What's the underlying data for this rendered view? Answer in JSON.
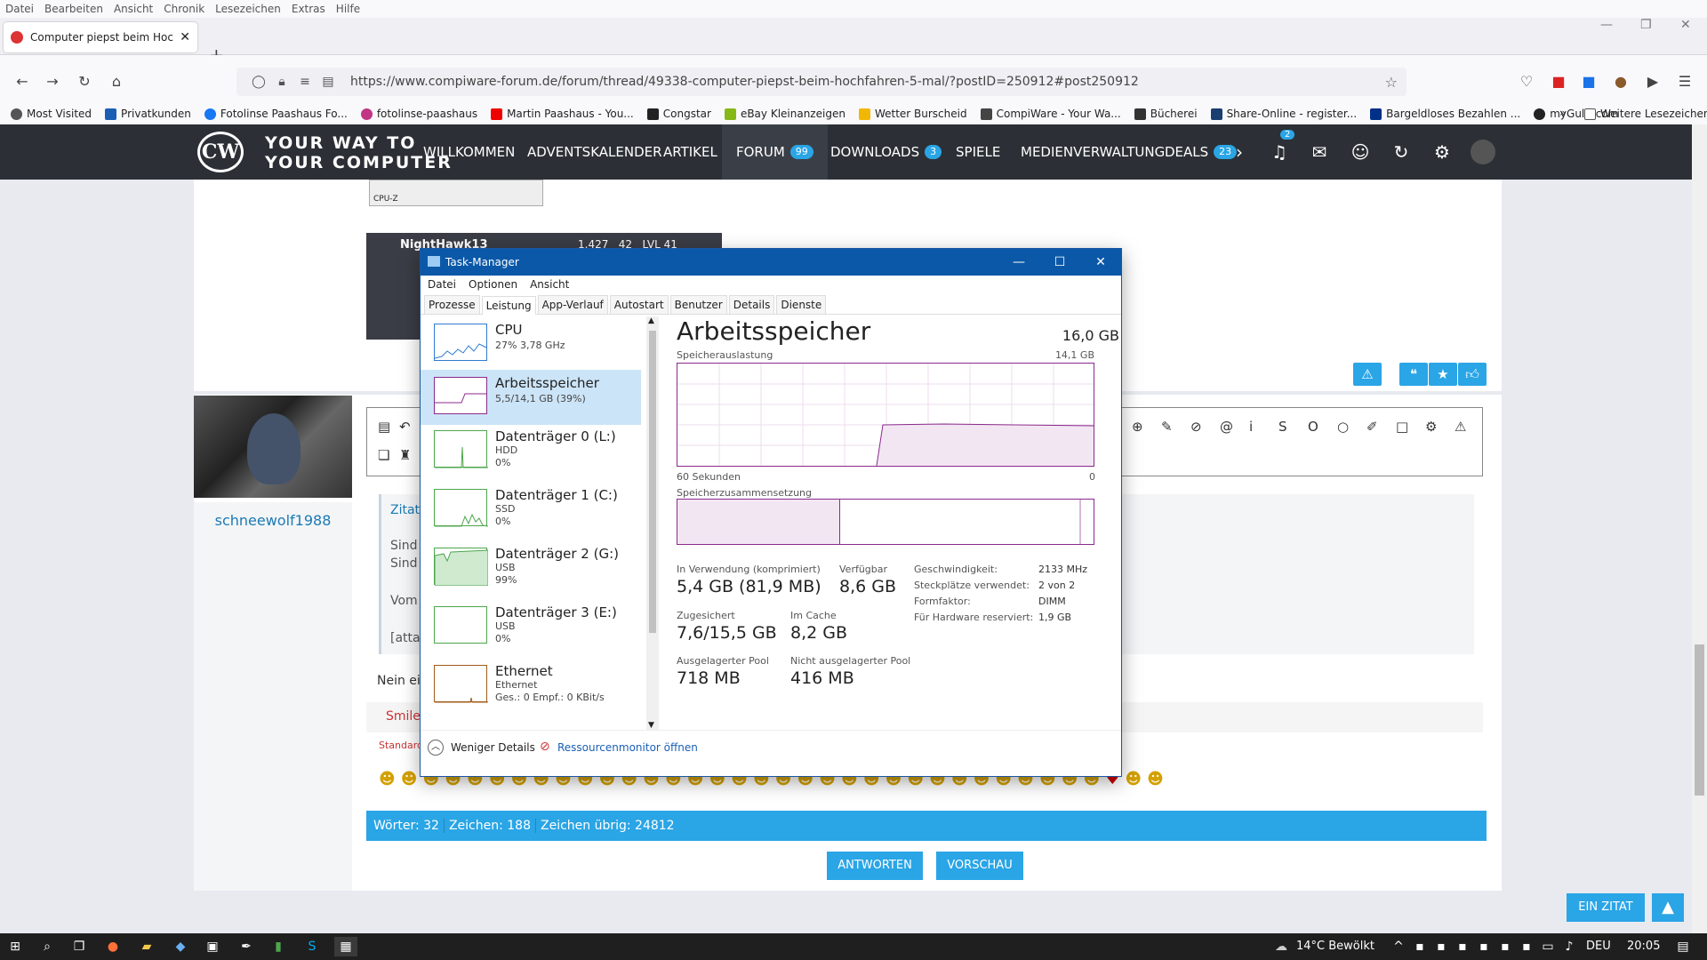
{
  "browser": {
    "menu": [
      "Datei",
      "Bearbeiten",
      "Ansicht",
      "Chronik",
      "Lesezeichen",
      "Extras",
      "Hilfe"
    ],
    "tab_title": "Computer piepst beim Hochfa",
    "url": "https://www.compiware-forum.de/forum/thread/49338-computer-piepst-beim-hochfahren-5-mal/?postID=250912#post250912",
    "bookmarks": [
      {
        "label": "Most Visited",
        "color": "#555"
      },
      {
        "label": "Privatkunden",
        "color": "#1a5fb4"
      },
      {
        "label": "Fotolinse Paashaus Fo...",
        "color": "#1877f2"
      },
      {
        "label": "fotolinse-paashaus",
        "color": "#c13584"
      },
      {
        "label": "Martin Paashaus - You...",
        "color": "#e00"
      },
      {
        "label": "Congstar",
        "color": "#222"
      },
      {
        "label": "eBay Kleinanzeigen",
        "color": "#86b817"
      },
      {
        "label": "Wetter Burscheid",
        "color": "#f2b705"
      },
      {
        "label": "CompiWare - Your Wa...",
        "color": "#444"
      },
      {
        "label": "Bücherei",
        "color": "#333"
      },
      {
        "label": "Share-Online - register...",
        "color": "#1a3e6f"
      },
      {
        "label": "Bargeldloses Bezahlen ...",
        "color": "#003087"
      },
      {
        "label": "myGully.com",
        "color": "#222"
      }
    ],
    "more_bookmarks": "Weitere Lesezeichen"
  },
  "site": {
    "logo": "CW",
    "slogan_line1": "YOUR WAY TO",
    "slogan_line2": "YOUR COMPUTER",
    "nav": [
      {
        "label": "WILLKOMMEN"
      },
      {
        "label": "ADVENTSKALENDER"
      },
      {
        "label": "ARTIKEL"
      },
      {
        "label": "FORUM",
        "badge": "99"
      },
      {
        "label": "DOWNLOADS",
        "badge": "3"
      },
      {
        "label": "SPIELE"
      },
      {
        "label": "MEDIENVERWALTUNG"
      },
      {
        "label": "DEALS",
        "badge": "23"
      }
    ],
    "notif_count": "2"
  },
  "post": {
    "prev_user": "NightHawk13",
    "prev_stats": "1.427   42   LVL 41",
    "prev_caption": "CPU-Z",
    "username": "schneewolf1988",
    "quote_label": "Zitat",
    "quote_lines": [
      "Sind",
      "Sind",
      "Vom",
      "[attac"
    ],
    "reply_text": "Nein eig",
    "smiley_tab": "Smiley",
    "smiley_std": "Standard",
    "word_count": "Wörter: 32",
    "char_count": "Zeichen: 188",
    "chars_left": "Zeichen übrig: 24812",
    "btn_reply": "ANTWORTEN",
    "btn_preview": "VORSCHAU",
    "btn_quote": "EIN ZITAT"
  },
  "taskmanager": {
    "title": "Task-Manager",
    "menu": [
      "Datei",
      "Optionen",
      "Ansicht"
    ],
    "tabs": [
      "Prozesse",
      "Leistung",
      "App-Verlauf",
      "Autostart",
      "Benutzer",
      "Details",
      "Dienste"
    ],
    "resources": [
      {
        "name": "CPU",
        "sub1": "27%  3,78 GHz",
        "sub2": ""
      },
      {
        "name": "Arbeitsspeicher",
        "sub1": "5,5/14,1 GB (39%)",
        "sub2": ""
      },
      {
        "name": "Datenträger 0 (L:)",
        "sub1": "HDD",
        "sub2": "0%"
      },
      {
        "name": "Datenträger 1 (C:)",
        "sub1": "SSD",
        "sub2": "0%"
      },
      {
        "name": "Datenträger 2 (G:)",
        "sub1": "USB",
        "sub2": "99%"
      },
      {
        "name": "Datenträger 3 (E:)",
        "sub1": "USB",
        "sub2": "0%"
      },
      {
        "name": "Ethernet",
        "sub1": "Ethernet",
        "sub2": "Ges.: 0  Empf.: 0 KBit/s"
      }
    ],
    "mem_title": "Arbeitsspeicher",
    "mem_total": "16,0 GB",
    "usage_label": "Speicherauslastung",
    "usage_max": "14,1 GB",
    "time_label": "60 Sekunden",
    "time_zero": "0",
    "comp_label": "Speicherzusammensetzung",
    "in_use_label": "In Verwendung (komprimiert)",
    "in_use_val": "5,4 GB (81,9 MB)",
    "avail_label": "Verfügbar",
    "avail_val": "8,6 GB",
    "committed_label": "Zugesichert",
    "committed_val": "7,6/15,5 GB",
    "cached_label": "Im Cache",
    "cached_val": "8,2 GB",
    "paged_label": "Ausgelagerter Pool",
    "paged_val": "718 MB",
    "nonpaged_label": "Nicht ausgelagerter Pool",
    "nonpaged_val": "416 MB",
    "speed_label": "Geschwindigkeit:",
    "speed_val": "2133 MHz",
    "slots_label": "Steckplätze verwendet:",
    "slots_val": "2 von 2",
    "form_label": "Formfaktor:",
    "form_val": "DIMM",
    "hw_label": "Für Hardware reserviert:",
    "hw_val": "1,9 GB",
    "less_details": "Weniger Details",
    "resmon": "Ressourcenmonitor öffnen"
  },
  "taskbar": {
    "weather": "14°C  Bewölkt",
    "lang": "DEU",
    "time": "20:05"
  }
}
